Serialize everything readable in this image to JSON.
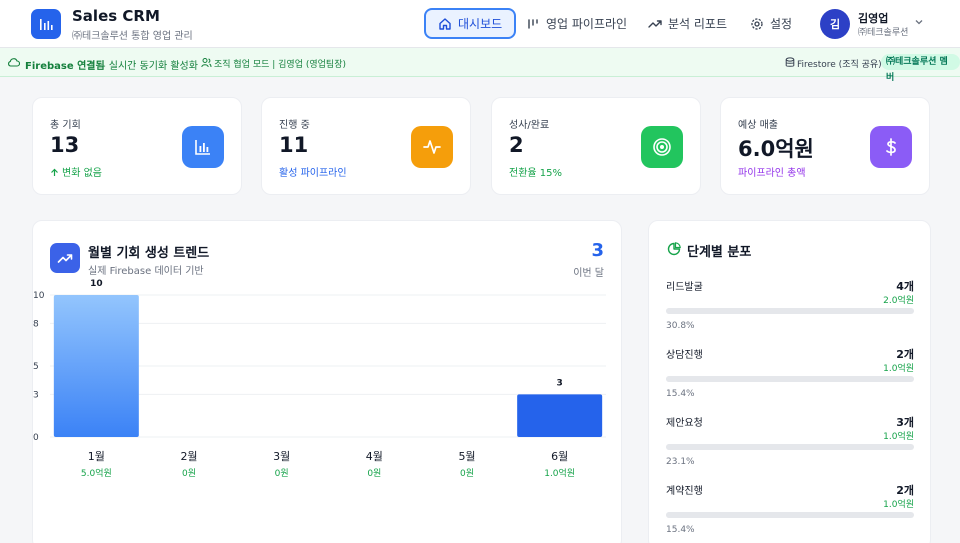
{
  "header": {
    "app_title": "Sales CRM",
    "app_subtitle": "㈜테크솔루션 통합 영업 관리",
    "nav": [
      {
        "label": "대시보드",
        "icon": "home-icon",
        "active": true
      },
      {
        "label": "영업 파이프라인",
        "icon": "pipeline-icon",
        "active": false
      },
      {
        "label": "분석 리포트",
        "icon": "trending-icon",
        "active": false
      },
      {
        "label": "설정",
        "icon": "gear-icon",
        "active": false
      }
    ],
    "user": {
      "initial": "김",
      "name": "김영업",
      "org": "㈜테크솔루션"
    }
  },
  "status_bar": {
    "connected": "Firebase 연결됨",
    "sync": "- 실시간 동기화 활성화",
    "team": "조직 협업 모드 | 김영업 (영업팀장)",
    "db": "Firestore (조직 공유)",
    "badge": "㈜테크솔루션 멤버"
  },
  "kpis": [
    {
      "label": "총 기회",
      "value": "13",
      "sub": "변화 없음",
      "sub_color": "#16a34a",
      "icon": "bar-chart-icon",
      "icon_bg": "#3b82f6"
    },
    {
      "label": "진행 중",
      "value": "11",
      "sub": "활성 파이프라인",
      "sub_color": "#2563eb",
      "icon": "activity-icon",
      "icon_bg": "#f59e0b"
    },
    {
      "label": "성사/완료",
      "value": "2",
      "sub": "전환율 15%",
      "sub_color": "#16a34a",
      "icon": "target-icon",
      "icon_bg": "#22c55e"
    },
    {
      "label": "예상 매출",
      "value": "6.0억원",
      "sub": "파이프라인 총액",
      "sub_color": "#9333ea",
      "icon": "dollar-icon",
      "icon_bg": "#8b5cf6"
    }
  ],
  "trend": {
    "title": "월별 기회 생성 트렌드",
    "subtitle": "실제 Firebase 데이터 기반",
    "current_value": "3",
    "current_label": "이번 달"
  },
  "chart_data": {
    "type": "bar",
    "categories": [
      "1월",
      "2월",
      "3월",
      "4월",
      "5월",
      "6월"
    ],
    "values": [
      10,
      0,
      0,
      0,
      0,
      3
    ],
    "amounts": [
      "5.0억원",
      "0원",
      "0원",
      "0원",
      "0원",
      "1.0억원"
    ],
    "yticks": [
      "10",
      "8",
      "5",
      "3",
      "0"
    ],
    "ylim": [
      0,
      10
    ],
    "grid": true,
    "bar_color_top": "#93c5fd",
    "bar_color_bottom": "#3b82f6"
  },
  "distribution": {
    "title": "단계별 분포",
    "stages": [
      {
        "name": "리드발굴",
        "count": "4개",
        "amount": "2.0억원",
        "pct": "30.8%",
        "fraction": 0.308
      },
      {
        "name": "상담진행",
        "count": "2개",
        "amount": "1.0억원",
        "pct": "15.4%",
        "fraction": 0.154
      },
      {
        "name": "제안요청",
        "count": "3개",
        "amount": "1.0억원",
        "pct": "23.1%",
        "fraction": 0.231
      },
      {
        "name": "계약진행",
        "count": "2개",
        "amount": "1.0억원",
        "pct": "15.4%",
        "fraction": 0.154
      }
    ]
  }
}
